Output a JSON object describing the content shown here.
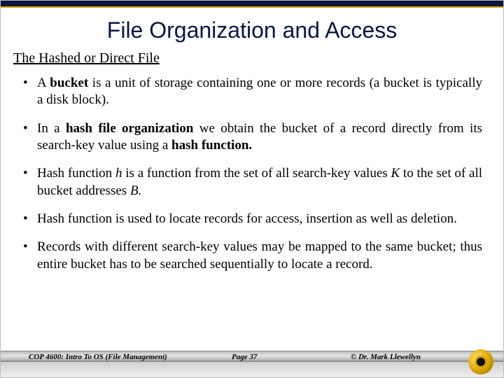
{
  "title": "File Organization and Access",
  "subtitle": "The Hashed or Direct File",
  "bullets": [
    {
      "pre": "A ",
      "b1": "bucket",
      "mid": " is a unit of storage containing one or more records (a bucket is typically a disk block)."
    },
    {
      "pre": "In a ",
      "b1": "hash file organization",
      "mid": " we obtain the bucket of a record directly from its search-key value using a ",
      "b2": "hash function."
    },
    {
      "pre": "Hash function ",
      "i1": "h",
      "mid": " is a function from the set of all search-key values ",
      "i2": "K",
      "mid2": " to the set of all bucket addresses ",
      "i3": "B.",
      "tail": ""
    },
    {
      "plain": "Hash function is used to locate records for access, insertion as well as deletion."
    },
    {
      "plain": "Records with different search-key values may be mapped to the same bucket; thus entire bucket has to be searched sequentially to locate a record."
    }
  ],
  "footer": {
    "left": "COP 4600: Intro To OS  (File Management)",
    "mid": "Page 37",
    "right": "© Dr. Mark Llewellyn"
  }
}
